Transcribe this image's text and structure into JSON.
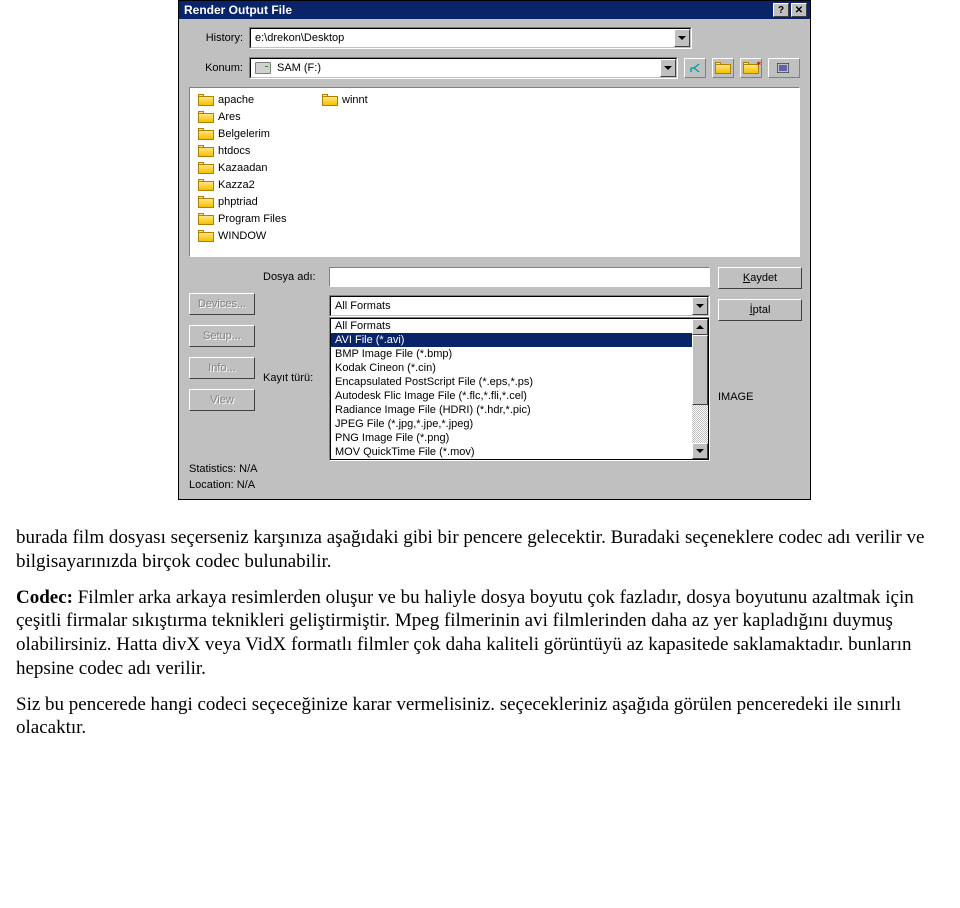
{
  "dialog": {
    "title": "Render Output File",
    "history_label": "History:",
    "history_value": "e:\\drekon\\Desktop",
    "location_label": "Konum:",
    "drive_label": "SAM (F:)",
    "folders_col1": [
      "apache",
      "Ares",
      "Belgelerim",
      "htdocs",
      "Kazaadan",
      "Kazza2"
    ],
    "folders_col2": [
      "phptriad",
      "Program Files",
      "WINDOW",
      "winnt"
    ],
    "filename_label": "Dosya adı:",
    "filename_value": "",
    "filetype_label": "Kayıt türü:",
    "filetype_selected": "All Formats",
    "format_options": [
      "All Formats",
      "AVI File (*.avi)",
      "BMP Image File (*.bmp)",
      "Kodak Cineon (*.cin)",
      "Encapsulated PostScript File (*.eps,*.ps)",
      "Autodesk Flic Image File (*.flc,*.fli,*.cel)",
      "Radiance Image File (HDRI) (*.hdr,*.pic)",
      "JPEG File (*.jpg,*.jpe,*.jpeg)",
      "PNG Image File (*.png)",
      "MOV QuickTime File (*.mov)"
    ],
    "selected_index": 1,
    "save_btn": "Kaydet",
    "save_accel": "K",
    "cancel_btn": "İptal",
    "cancel_accel": "İ",
    "left_btns": [
      "Devices...",
      "Setup...",
      "Info...",
      "View"
    ],
    "right_label": "IMAGE",
    "stat_label": "Statistics:",
    "stat_value": "N/A",
    "loc_label": "Location:",
    "loc_value": "N/A"
  },
  "paragraphs": {
    "p1": "burada film dosyası seçerseniz karşınıza aşağıdaki gibi bir pencere gelecektir. Buradaki seçeneklere codec adı verilir ve bilgisayarınızda birçok codec bulunabilir.",
    "p2_label": "Codec:",
    "p2_rest": " Filmler arka arkaya resimlerden oluşur ve bu haliyle dosya boyutu çok fazladır, dosya boyutunu azaltmak için çeşitli firmalar sıkıştırma teknikleri geliştirmiştir. Mpeg filmerinin avi filmlerinden daha az yer kapladığını duymuş olabilirsiniz. Hatta divX veya VidX formatlı filmler çok daha kaliteli görüntüyü az kapasitede saklamaktadır. bunların hepsine codec adı verilir.",
    "p3": "Siz bu pencerede hangi codeci seçeceğinize karar vermelisiniz. seçecekleriniz aşağıda görülen penceredeki ile sınırlı olacaktır."
  }
}
